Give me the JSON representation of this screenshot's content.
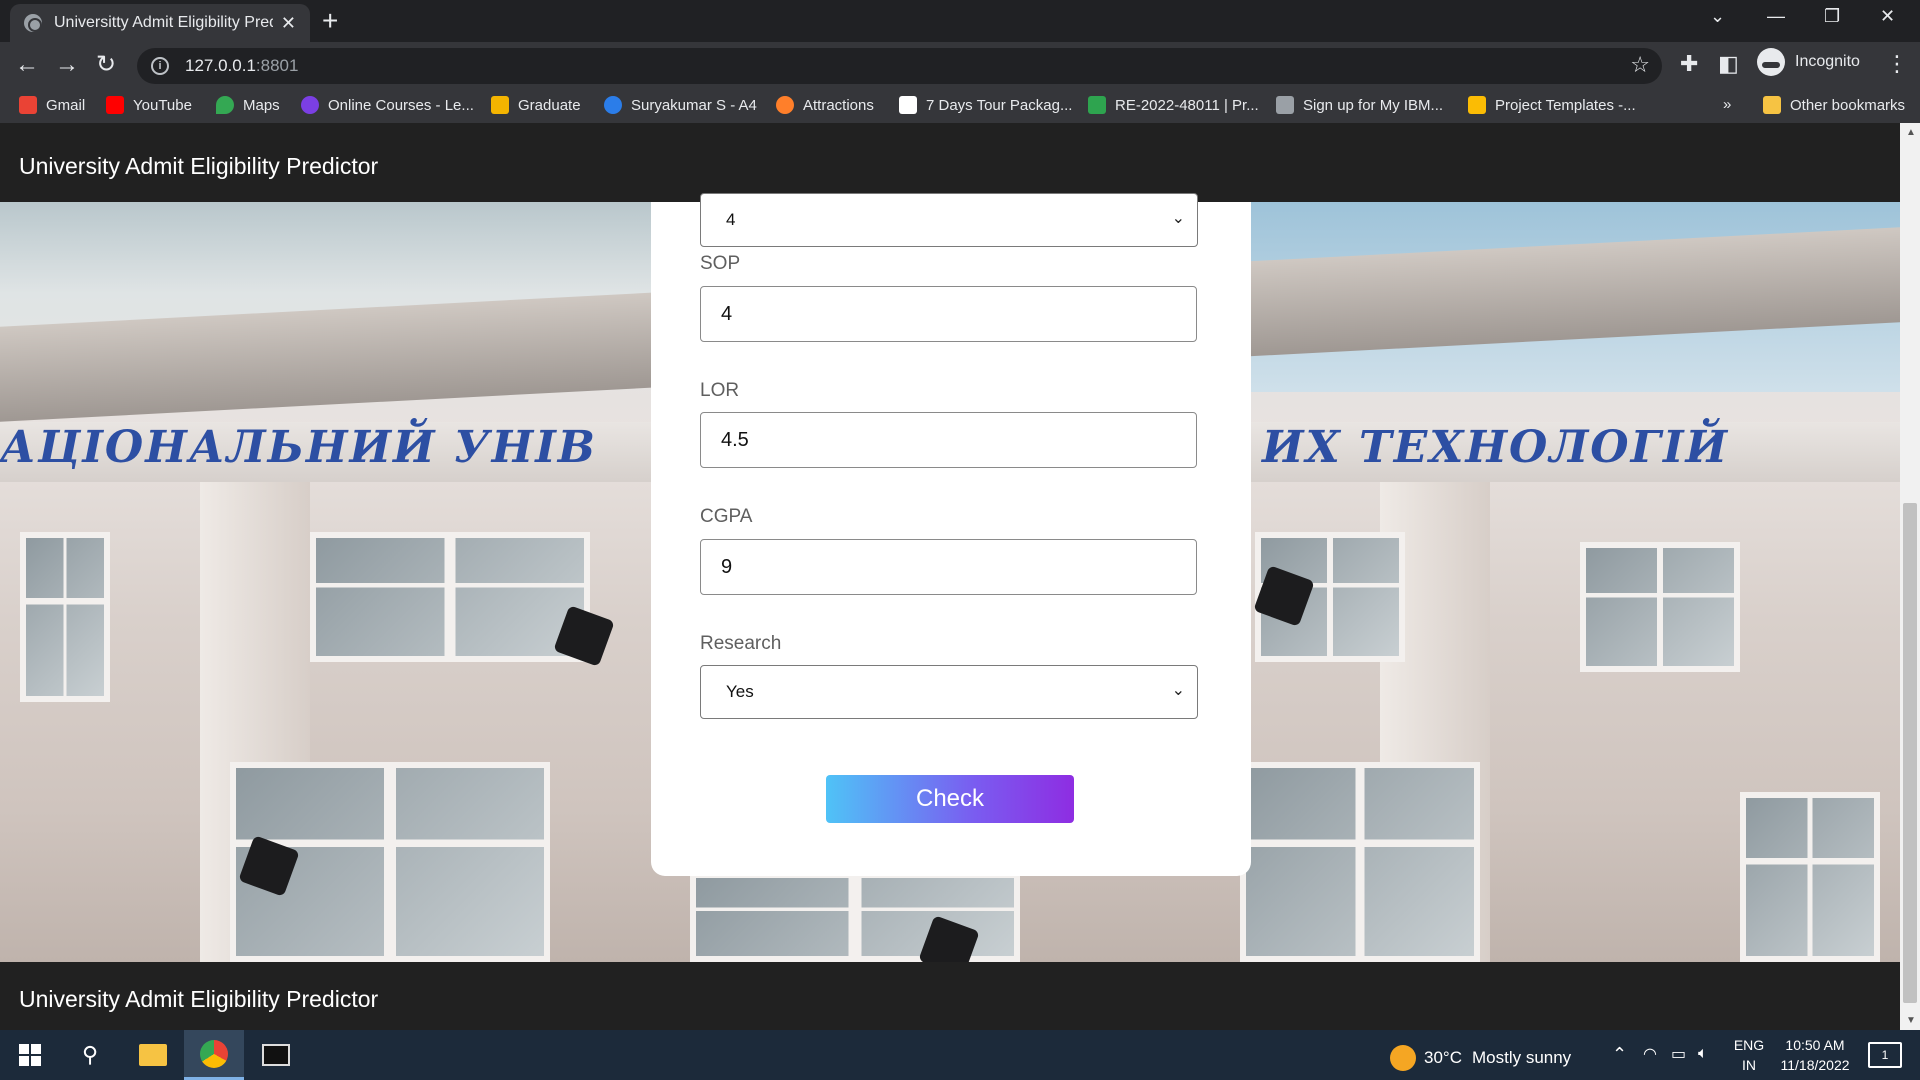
{
  "browser": {
    "tab_title": "Universitty Admit Eligibility Predi",
    "url_host": "127.0.0.1",
    "url_port": ":8801",
    "profile_label": "Incognito",
    "bookmarks": [
      {
        "label": "Gmail",
        "color": "#ea4335"
      },
      {
        "label": "YouTube",
        "color": "#ff0000"
      },
      {
        "label": "Maps",
        "color": "#34a853"
      },
      {
        "label": "Online Courses - Le...",
        "color": "#7b3fe4"
      },
      {
        "label": "Graduate",
        "color": "#f4b400"
      },
      {
        "label": "Suryakumar S - A4",
        "color": "#2b7de9"
      },
      {
        "label": "Attractions",
        "color": "#ff7f2a"
      },
      {
        "label": "7 Days Tour Packag...",
        "color": "#ffffff"
      },
      {
        "label": "RE-2022-48011 | Pr...",
        "color": "#2ea44f"
      },
      {
        "label": "Sign up for My IBM...",
        "color": "#9aa0a6"
      },
      {
        "label": "Project Templates -...",
        "color": "#fbbc04"
      }
    ],
    "more_bookmarks": "»",
    "other_bookmarks": "Other bookmarks"
  },
  "page": {
    "navbar_title": "University Admit Eligibility Predictor",
    "footer_title": "University Admit Eligibility Predictor",
    "hero_sign_left": "АЦІОНАЛЬНИЙ УНІВ",
    "hero_sign_right": "ИХ ТЕХНОЛОГІЙ",
    "form": {
      "top_select_value": "4",
      "sop_label": "SOP",
      "sop_value": "4",
      "lor_label": "LOR",
      "lor_value": "4.5",
      "cgpa_label": "CGPA",
      "cgpa_value": "9",
      "research_label": "Research",
      "research_value": "Yes",
      "check_label": "Check"
    }
  },
  "taskbar": {
    "weather_temp": "30°C",
    "weather_desc": "Mostly sunny",
    "lang_top": "ENG",
    "lang_bottom": "IN",
    "time": "10:50 AM",
    "date": "11/18/2022",
    "notification_count": "1"
  }
}
